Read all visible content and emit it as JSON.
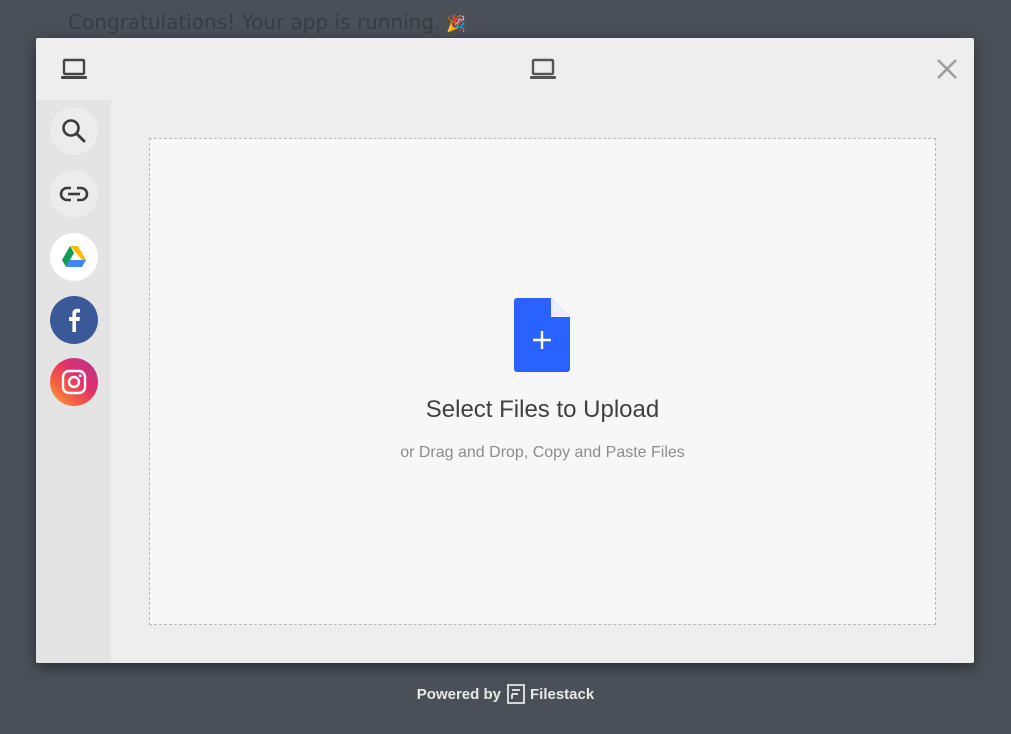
{
  "background": {
    "message": "Congratulations! Your app is running.",
    "emoji": "🎉"
  },
  "header": {
    "left_icon": "laptop-icon",
    "center_icon": "laptop-icon",
    "close_icon": "close-icon"
  },
  "sidebar": {
    "items": [
      {
        "name": "search",
        "icon": "search-icon"
      },
      {
        "name": "link",
        "icon": "link-icon"
      },
      {
        "name": "google-drive",
        "icon": "google-drive-icon"
      },
      {
        "name": "facebook",
        "icon": "facebook-icon",
        "color": "#3b5998"
      },
      {
        "name": "instagram",
        "icon": "instagram-icon"
      }
    ]
  },
  "dropzone": {
    "title": "Select Files to Upload",
    "subtitle": "or Drag and Drop, Copy and Paste Files",
    "icon": "file-add-icon",
    "icon_color": "#2962ff"
  },
  "footer": {
    "powered_by": "Powered by",
    "brand": "Filestack"
  }
}
